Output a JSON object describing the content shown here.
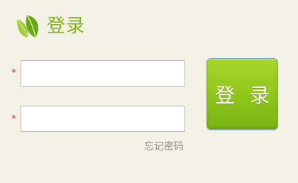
{
  "header": {
    "logo_icon": "leaf-icon",
    "title": "登录"
  },
  "form": {
    "required_mark": "*",
    "field1_value": "",
    "field2_value": "",
    "forgot_password": "忘记密码",
    "submit_label": "登 录"
  },
  "colors": {
    "background": "#f4f1e6",
    "accent_green": "#7fb518",
    "button_green": "#8ec51a",
    "required_red": "#e03030"
  }
}
